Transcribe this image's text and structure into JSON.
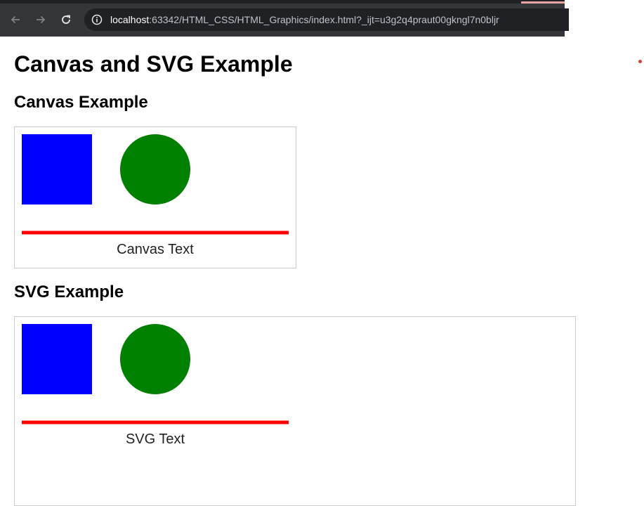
{
  "browser": {
    "url_host": "localhost",
    "url_rest": ":63342/HTML_CSS/HTML_Graphics/index.html?_ijt=u3g2q4praut00gkngl7n0bljr",
    "icons": [
      "back-arrow-icon",
      "forward-arrow-icon",
      "reload-icon",
      "site-info-icon"
    ]
  },
  "page": {
    "title": "Canvas and SVG Example",
    "canvas_section": {
      "heading": "Canvas Example",
      "text": "Canvas Text"
    },
    "svg_section": {
      "heading": "SVG Example",
      "text": "SVG Text"
    }
  },
  "colors": {
    "square": "#0000ff",
    "circle": "#008000",
    "line": "#ff0000",
    "chrome_bg": "#35363a",
    "omnibox_bg": "#202124"
  }
}
